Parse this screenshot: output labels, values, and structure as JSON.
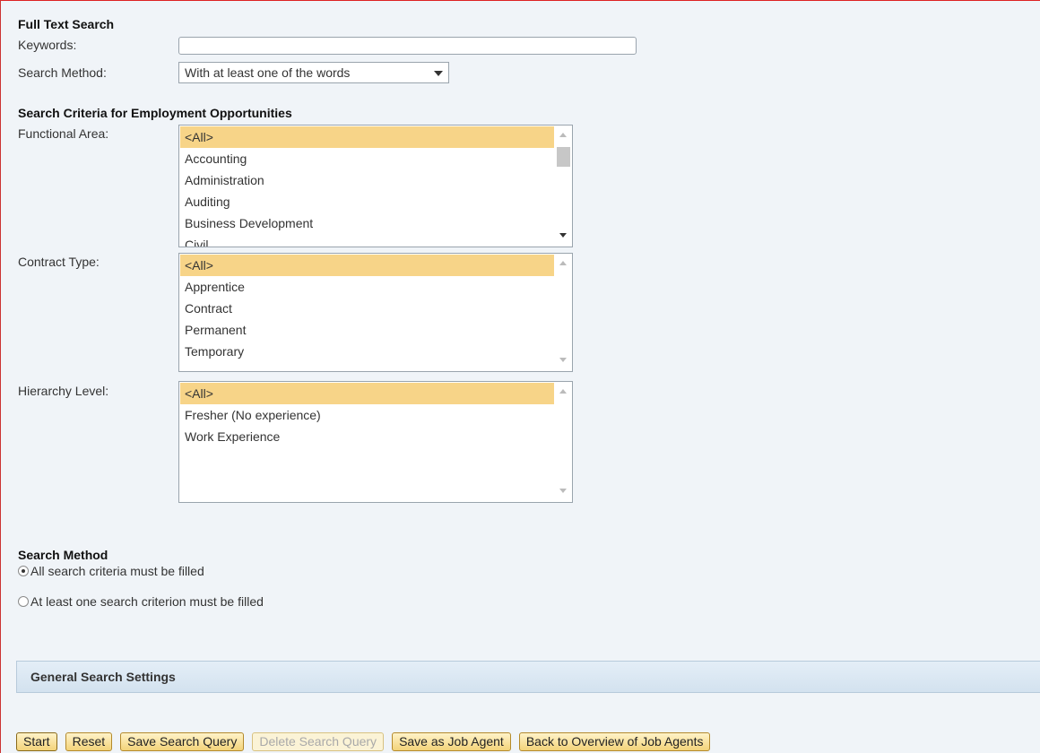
{
  "full_text_search": {
    "title": "Full Text Search",
    "keywords_label": "Keywords:",
    "keywords_value": "",
    "method_label": "Search Method:",
    "method_selected": "With at least one of the words"
  },
  "criteria": {
    "title": "Search Criteria for Employment Opportunities",
    "functional_area": {
      "label": "Functional Area:",
      "items": [
        "<All>",
        "Accounting",
        "Administration",
        "Auditing",
        "Business Development",
        "Civil"
      ]
    },
    "contract_type": {
      "label": "Contract Type:",
      "items": [
        "<All>",
        "Apprentice",
        "Contract",
        "Permanent",
        "Temporary"
      ]
    },
    "hierarchy_level": {
      "label": "Hierarchy Level:",
      "items": [
        "<All>",
        "Fresher (No experience)",
        "Work Experience"
      ]
    }
  },
  "search_method": {
    "title": "Search Method",
    "options": [
      "All search criteria must be filled",
      "At least one search criterion must be filled"
    ],
    "selected_index": 0
  },
  "general_settings": {
    "title": "General Search Settings"
  },
  "buttons": {
    "start": "Start",
    "reset": "Reset",
    "save_query": "Save Search Query",
    "delete_query": "Delete Search Query",
    "save_agent": "Save as Job Agent",
    "back_overview": "Back to Overview of Job Agents"
  },
  "colors": {
    "background": "#f0f4f8",
    "selection": "#f7d488",
    "button": "#f3d37a",
    "frame": "#dd2222"
  }
}
